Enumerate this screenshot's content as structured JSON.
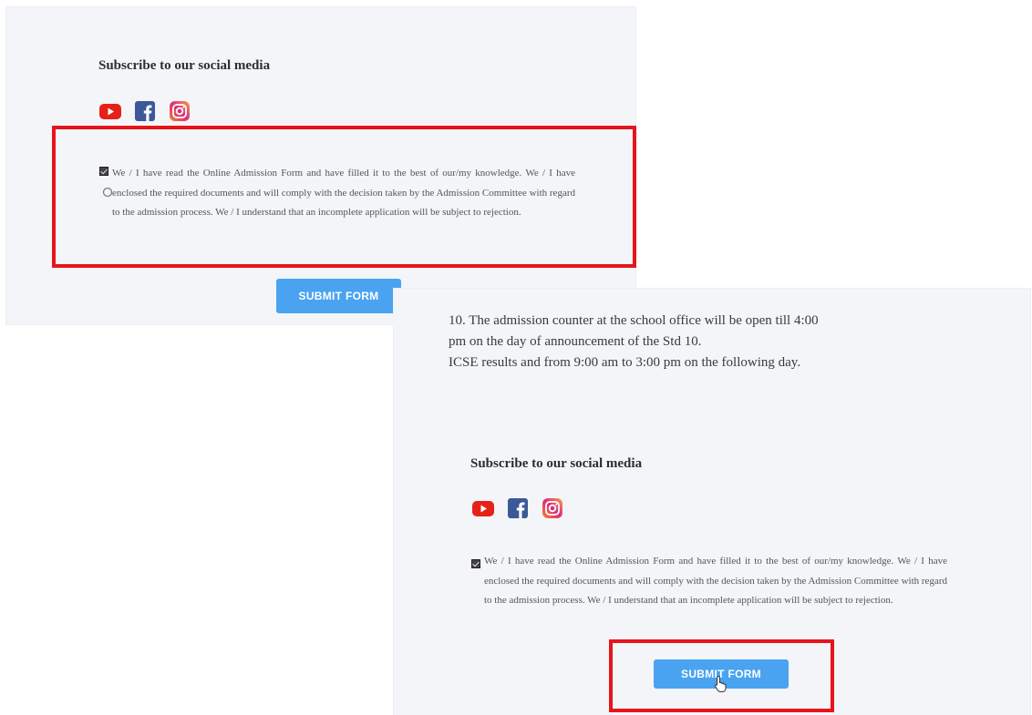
{
  "top_panel": {
    "social_heading": "Subscribe to our social media",
    "consent_text": "We / I have read the Online Admission Form and have filled it to the best of our/my knowledge. We / I have enclosed the required documents and will comply with the decision taken by the Admission Committee with regard to the admission process. We / I understand that an incomplete application will be subject to rejection.",
    "submit_label": "SUBMIT FORM"
  },
  "bottom_panel": {
    "info_lines": [
      "10. The admission counter at the school office will be open till 4:00",
      "pm on the day of announcement of the Std 10.",
      "ICSE results and from 9:00 am to 3:00 pm on the following day."
    ],
    "social_heading": "Subscribe to our social media",
    "consent_text": "We / I have read the Online Admission Form and have filled it to the best of our/my knowledge. We / I have enclosed the required documents and will comply with the decision taken by the Admission Committee with regard to the admission process. We / I understand that an incomplete application will be subject to rejection.",
    "submit_label": "SUBMIT FORM"
  },
  "social_icons": [
    "youtube-icon",
    "facebook-icon",
    "instagram-icon"
  ],
  "colors": {
    "highlight": "#e8141c",
    "button": "#4aa3f0",
    "youtube": "#e62117",
    "facebook": "#3b5998",
    "instagram_start": "#f58529",
    "instagram_end": "#dd2a7b"
  }
}
